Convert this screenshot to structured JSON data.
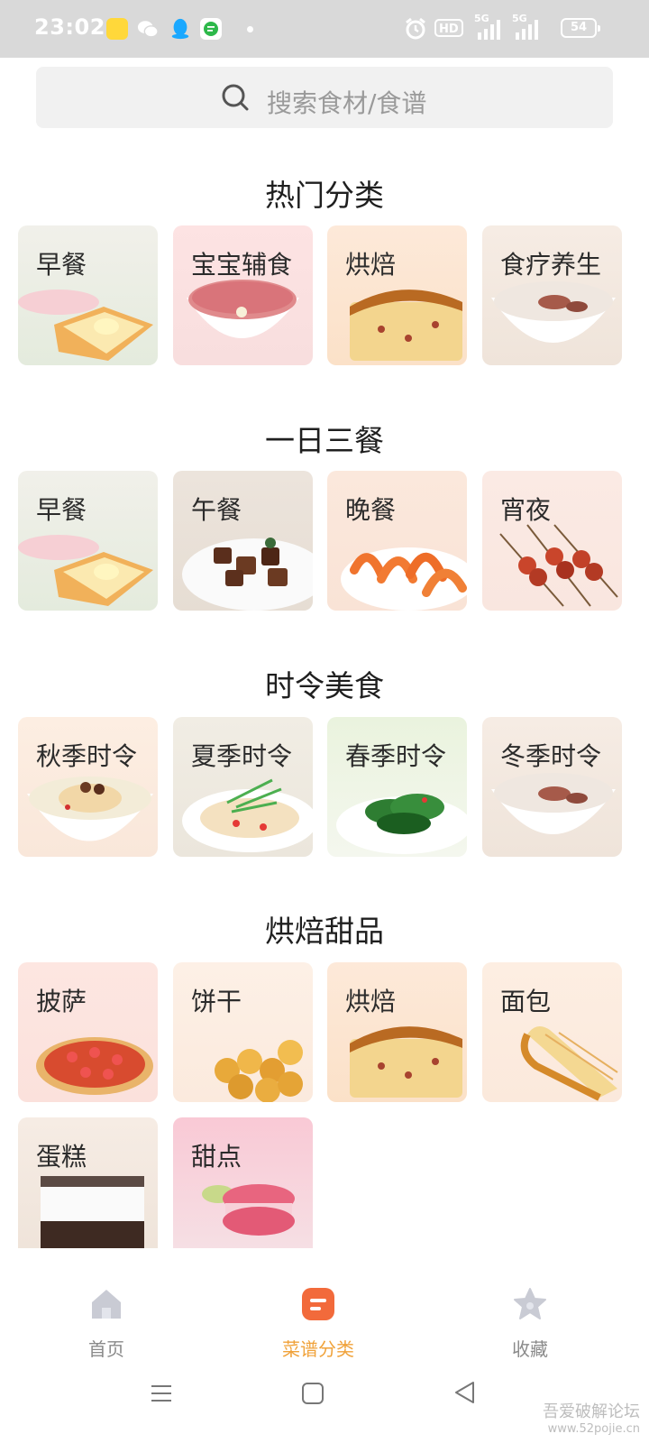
{
  "status_bar": {
    "time": "23:02",
    "app_icons": [
      "app-yellow-icon",
      "wechat-icon",
      "qq-icon",
      "messages-icon"
    ],
    "battery": "54",
    "hd_label": "HD",
    "network": "5G"
  },
  "search": {
    "placeholder": "搜索食材/食谱"
  },
  "sections": [
    {
      "title": "热门分类",
      "items": [
        {
          "label": "早餐"
        },
        {
          "label": "宝宝辅食"
        },
        {
          "label": "烘焙"
        },
        {
          "label": "食疗养生"
        }
      ]
    },
    {
      "title": "一日三餐",
      "items": [
        {
          "label": "早餐"
        },
        {
          "label": "午餐"
        },
        {
          "label": "晚餐"
        },
        {
          "label": "宵夜"
        }
      ]
    },
    {
      "title": "时令美食",
      "items": [
        {
          "label": "秋季时令"
        },
        {
          "label": "夏季时令"
        },
        {
          "label": "春季时令"
        },
        {
          "label": "冬季时令"
        }
      ]
    },
    {
      "title": "烘焙甜品",
      "items": [
        {
          "label": "披萨"
        },
        {
          "label": "饼干"
        },
        {
          "label": "烘焙"
        },
        {
          "label": "面包"
        },
        {
          "label": "蛋糕"
        },
        {
          "label": "甜点"
        }
      ]
    }
  ],
  "bottom_nav": {
    "items": [
      {
        "label": "首页",
        "icon": "home-icon",
        "active": false
      },
      {
        "label": "菜谱分类",
        "icon": "recipe-category-icon",
        "active": true
      },
      {
        "label": "收藏",
        "icon": "star-icon",
        "active": false
      }
    ],
    "active_color": "#f0a23a",
    "inactive_color": "#8a8a8a"
  },
  "watermark": {
    "line1": "吾爱破解论坛",
    "line2": "www.52pojie.cn"
  }
}
